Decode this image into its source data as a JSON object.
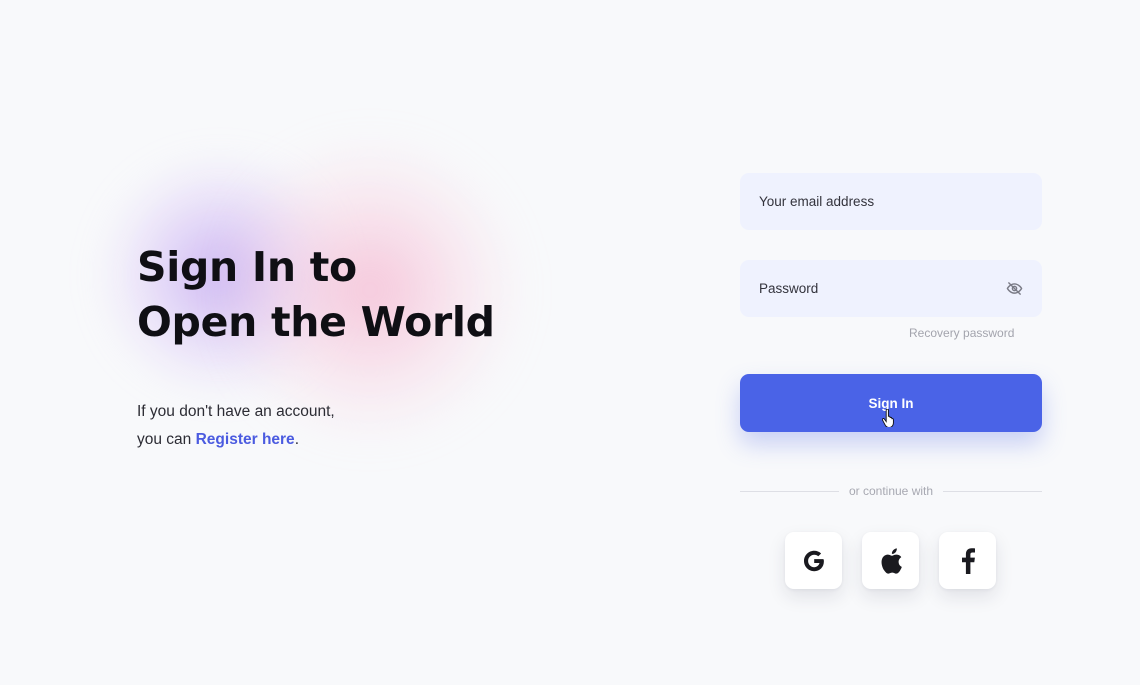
{
  "hero": {
    "headline_line1": "Sign In to",
    "headline_line2": "Open the World",
    "subtext_line1": "If you don't have an account,",
    "subtext_prefix": "you can ",
    "register_link": "Register here",
    "subtext_suffix": "."
  },
  "form": {
    "email_placeholder": "Your email address",
    "password_placeholder": "Password",
    "recovery_link": "Recovery password",
    "signin_label": "Sign In",
    "divider_text": "or continue with"
  },
  "social": [
    {
      "name": "google",
      "icon": "google-icon"
    },
    {
      "name": "apple",
      "icon": "apple-icon"
    },
    {
      "name": "facebook",
      "icon": "facebook-icon"
    }
  ],
  "colors": {
    "accent": "#4a63e7",
    "input_bg": "#eff2fe",
    "page_bg": "#f8f9fb",
    "heading": "#0f0f14",
    "link": "#4b5be0",
    "muted": "#a3a4ad"
  }
}
